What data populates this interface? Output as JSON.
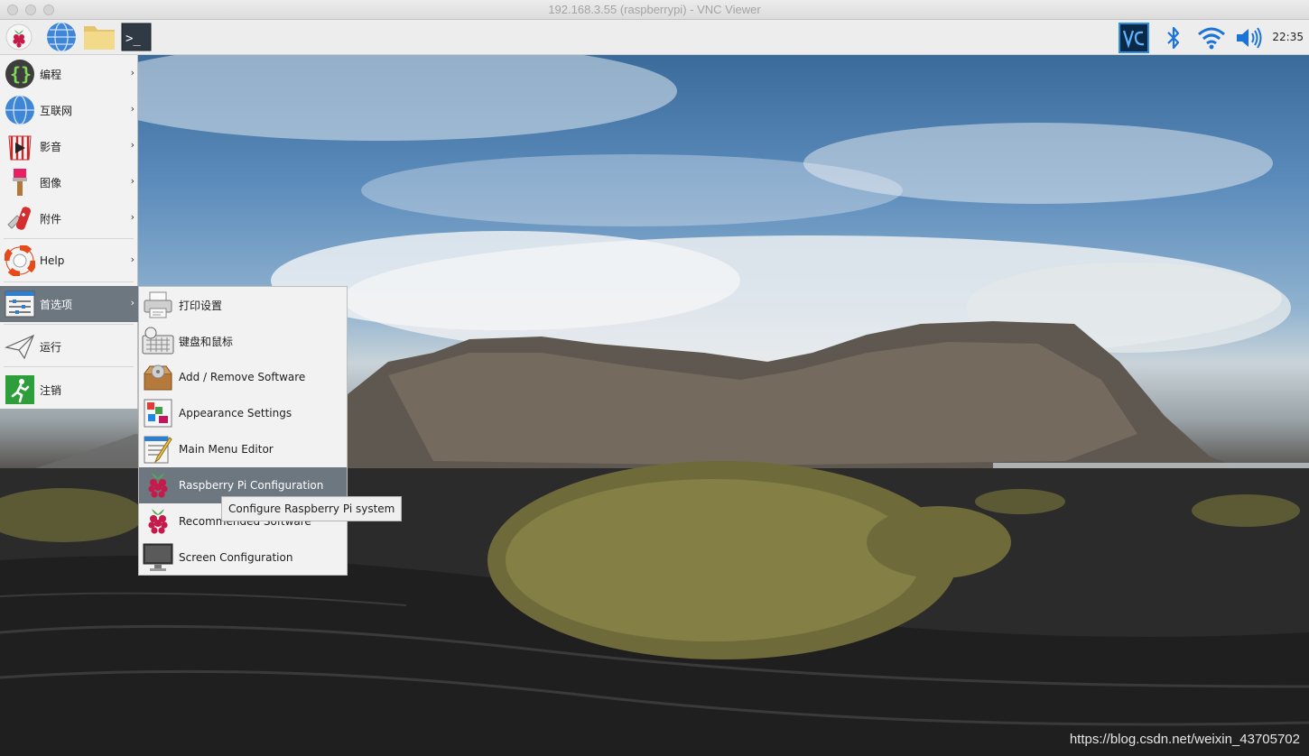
{
  "window": {
    "title": "192.168.3.55 (raspberrypi) - VNC Viewer"
  },
  "panel": {
    "launchers": [
      {
        "name": "raspberry-menu",
        "icon": "raspberry-icon"
      },
      {
        "name": "web-browser",
        "icon": "globe-icon"
      },
      {
        "name": "file-manager",
        "icon": "folder-icon"
      },
      {
        "name": "terminal",
        "icon": "terminal-icon"
      }
    ],
    "tray": [
      "vnc-icon",
      "bluetooth-icon",
      "wifi-icon",
      "volume-icon"
    ],
    "clock": "22:35"
  },
  "main_menu": {
    "items": [
      {
        "label": "编程",
        "icon": "code-braces-icon",
        "has_submenu": true
      },
      {
        "label": "互联网",
        "icon": "globe-icon",
        "has_submenu": true
      },
      {
        "label": "影音",
        "icon": "media-icon",
        "has_submenu": true
      },
      {
        "label": "图像",
        "icon": "paintbrush-icon",
        "has_submenu": true
      },
      {
        "label": "附件",
        "icon": "pocketknife-icon",
        "has_submenu": true
      },
      {
        "label": "Help",
        "icon": "lifebuoy-icon",
        "has_submenu": true
      },
      {
        "label": "首选项",
        "icon": "preferences-icon",
        "has_submenu": true,
        "active": true
      },
      {
        "label": "运行",
        "icon": "paper-plane-icon",
        "has_submenu": false
      },
      {
        "label": "注销",
        "icon": "exit-icon",
        "has_submenu": false
      }
    ]
  },
  "submenu": {
    "items": [
      {
        "label": "打印设置",
        "icon": "printer-icon"
      },
      {
        "label": "键盘和鼠标",
        "icon": "keyboard-mouse-icon"
      },
      {
        "label": "Add / Remove Software",
        "icon": "software-box-icon"
      },
      {
        "label": "Appearance Settings",
        "icon": "appearance-icon"
      },
      {
        "label": "Main Menu Editor",
        "icon": "menu-editor-icon"
      },
      {
        "label": "Raspberry Pi Configuration",
        "icon": "raspberry-icon",
        "active": true
      },
      {
        "label": "Recommended Software",
        "icon": "raspberry-icon"
      },
      {
        "label": "Screen Configuration",
        "icon": "monitor-icon"
      }
    ]
  },
  "tooltip": {
    "text": "Configure Raspberry Pi system"
  },
  "watermark": "https://blog.csdn.net/weixin_43705702",
  "colors": {
    "menu_highlight": "#6d7780",
    "menu_bg": "#f2f2f2"
  }
}
